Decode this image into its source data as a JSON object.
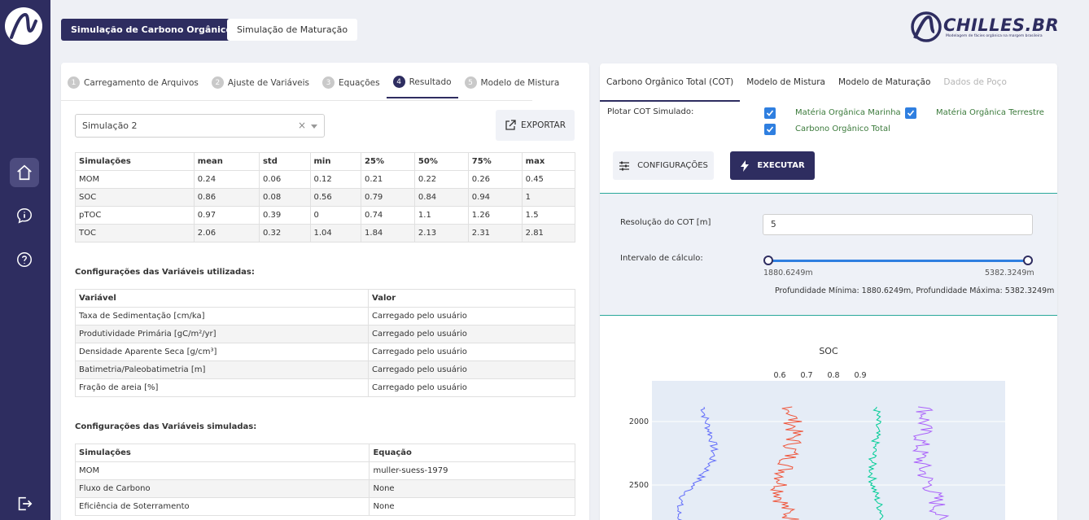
{
  "top_tabs": {
    "carbon": "Simulação de Carbono Orgânico Total",
    "maturation": "Simulação de Maturação"
  },
  "brand": {
    "name": "CHILLES.BR",
    "tagline": "Modelagem de fácies orgânica na margem brasileira"
  },
  "steps": [
    {
      "num": "1",
      "label": "Carregamento de Arquivos"
    },
    {
      "num": "2",
      "label": "Ajuste de Variáveis"
    },
    {
      "num": "3",
      "label": "Equações"
    },
    {
      "num": "4",
      "label": "Resultado"
    },
    {
      "num": "5",
      "label": "Modelo de Mistura"
    }
  ],
  "select_value": "Simulação 2",
  "export_label": "EXPORTAR",
  "stats_table": {
    "headers": [
      "Simulações",
      "mean",
      "std",
      "min",
      "25%",
      "50%",
      "75%",
      "max"
    ],
    "rows": [
      [
        "MOM",
        "0.24",
        "0.06",
        "0.12",
        "0.21",
        "0.22",
        "0.26",
        "0.45"
      ],
      [
        "SOC",
        "0.86",
        "0.08",
        "0.56",
        "0.79",
        "0.84",
        "0.94",
        "1"
      ],
      [
        "pTOC",
        "0.97",
        "0.39",
        "0",
        "0.74",
        "1.1",
        "1.26",
        "1.5"
      ],
      [
        "TOC",
        "2.06",
        "0.32",
        "1.04",
        "1.84",
        "2.13",
        "2.31",
        "2.81"
      ]
    ]
  },
  "vars_title": "Configurações das Variáveis utilizadas:",
  "vars_table": {
    "headers": [
      "Variável",
      "Valor"
    ],
    "rows": [
      [
        "Taxa de Sedimentação [cm/ka]",
        "Carregado pelo usuário"
      ],
      [
        "Produtividade Primária [gC/m²/yr]",
        "Carregado pelo usuário"
      ],
      [
        "Densidade Aparente Seca [g/cm³]",
        "Carregado pelo usuário"
      ],
      [
        "Batimetria/Paleobatimetria [m]",
        "Carregado pelo usuário"
      ],
      [
        "Fração de areia [%]",
        "Carregado pelo usuário"
      ]
    ]
  },
  "sims_title": "Configurações das Variáveis simuladas:",
  "sims_table": {
    "headers": [
      "Simulações",
      "Equação"
    ],
    "rows": [
      [
        "MOM",
        "muller-suess-1979"
      ],
      [
        "Fluxo de Carbono",
        "None"
      ],
      [
        "Eficiência de Soterramento",
        "None"
      ]
    ]
  },
  "right_tabs": [
    "Carbono Orgânico Total (COT)",
    "Modelo de Mistura",
    "Modelo de Maturação",
    "Dados de Poço"
  ],
  "plot_label": "Plotar COT Simulado:",
  "checkboxes": {
    "marine": "Matéria Orgânica Marinha",
    "terrestrial": "Matéria Orgânica Terrestre",
    "toc": "Carbono Orgânico Total"
  },
  "config_button": "CONFIGURAÇÕES",
  "run_button": "EXECUTAR",
  "resolution_label": "Resolução do COT [m]",
  "resolution_value": "5",
  "interval_label": "Intervalo de cálculo:",
  "slider": {
    "min_label": "1880.6249m",
    "max_label": "5382.3249m",
    "summary": "Profundidade Mínima: 1880.6249m, Profundidade Máxima: 5382.3249m"
  },
  "colors": {
    "primary": "#2e2d60",
    "accent": "#2f7fe0",
    "teal": "#29a89a"
  },
  "chart_data": {
    "type": "line",
    "title": "SOC",
    "x_ticks": [
      "0.6",
      "0.7",
      "0.8",
      "0.9"
    ],
    "y_ticks": [
      "2000",
      "2500"
    ],
    "ylim": [
      1820,
      2750
    ],
    "series_colors": [
      "#636efa",
      "#ef553b",
      "#00cc96",
      "#ab63fa"
    ]
  }
}
